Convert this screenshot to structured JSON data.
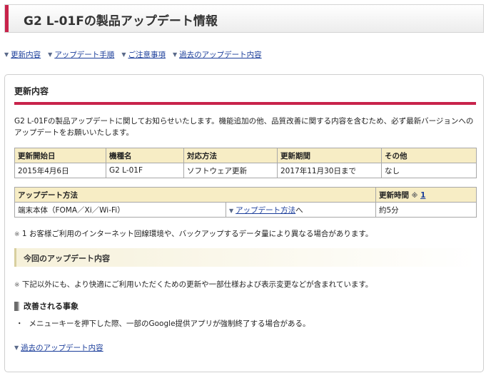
{
  "header": {
    "title": "G2 L-01Fの製品アップデート情報"
  },
  "nav": {
    "items": [
      {
        "label": "更新内容"
      },
      {
        "label": "アップデート手順"
      },
      {
        "label": "ご注意事項"
      },
      {
        "label": "過去のアップデート内容"
      }
    ]
  },
  "panel": {
    "heading": "更新内容",
    "intro": "G2 L-01Fの製品アップデートに関してお知らせいたします。機能追加の他、品質改善に関する内容を含むため、必ず最新バージョンへのアップデートをお願いいたします。",
    "info_table": {
      "headers": [
        "更新開始日",
        "機種名",
        "対応方法",
        "更新期間",
        "その他"
      ],
      "row": [
        "2015年4月6日",
        "G2 L-01F",
        "ソフトウェア更新",
        "2017年11月30日まで",
        "なし"
      ]
    },
    "method_table": {
      "header_method": "アップデート方法",
      "header_time": "更新時間",
      "header_time_mark": "※",
      "header_time_ref": "1",
      "method": "端末本体（FOMA／Xi／Wi-Fi）",
      "link_label": "アップデート方法",
      "link_suffix": "へ",
      "time": "約5分"
    },
    "note1_mark": "※",
    "note1": "1 お客様ご利用のインターネット回線環境や、バックアップするデータ量により異なる場合があります。",
    "sub_heading": "今回のアップデート内容",
    "note2_mark": "※",
    "note2": "下記以外にも、より快適にご利用いただくための更新や一部仕様および表示変更などが含まれています。",
    "improvements_heading": "改善される事象",
    "improvements": [
      "メニューキーを押下した際、一部のGoogle提供アプリが強制終了する場合がある。"
    ],
    "past_link": "過去のアップデート内容"
  },
  "icons": {
    "nav_arrow": "triangle-down-icon"
  },
  "colors": {
    "accent": "#c8234b",
    "table_header": "#f7edc5",
    "link": "#1a3d9a"
  }
}
